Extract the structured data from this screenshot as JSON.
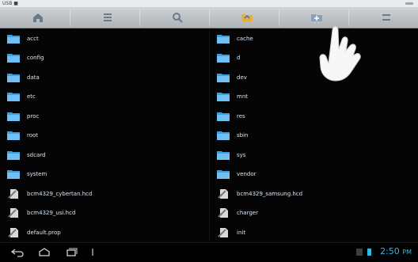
{
  "status": {
    "left_text": "USB ■"
  },
  "toolbar": {
    "buttons": [
      {
        "name": "home-icon"
      },
      {
        "name": "list-view-icon"
      },
      {
        "name": "search-icon"
      },
      {
        "name": "folder-up-icon"
      },
      {
        "name": "new-folder-icon"
      },
      {
        "name": "menu-icon"
      }
    ]
  },
  "files": {
    "left": [
      {
        "name": "acct",
        "type": "folder"
      },
      {
        "name": "config",
        "type": "folder"
      },
      {
        "name": "data",
        "type": "folder"
      },
      {
        "name": "etc",
        "type": "folder"
      },
      {
        "name": "proc",
        "type": "folder"
      },
      {
        "name": "root",
        "type": "folder"
      },
      {
        "name": "sdcard",
        "type": "folder"
      },
      {
        "name": "system",
        "type": "folder"
      },
      {
        "name": "bcm4329_cybertan.hcd",
        "type": "file"
      },
      {
        "name": "bcm4329_usi.hcd",
        "type": "file"
      },
      {
        "name": "default.prop",
        "type": "file"
      }
    ],
    "right": [
      {
        "name": "cache",
        "type": "folder"
      },
      {
        "name": "d",
        "type": "folder"
      },
      {
        "name": "dev",
        "type": "folder"
      },
      {
        "name": "mnt",
        "type": "folder"
      },
      {
        "name": "res",
        "type": "folder"
      },
      {
        "name": "sbin",
        "type": "folder"
      },
      {
        "name": "sys",
        "type": "folder"
      },
      {
        "name": "vendor",
        "type": "folder"
      },
      {
        "name": "bcm4329_samsung.hcd",
        "type": "file"
      },
      {
        "name": "charger",
        "type": "file"
      },
      {
        "name": "init",
        "type": "file"
      }
    ]
  },
  "navbar": {
    "buttons": [
      {
        "name": "back-icon"
      },
      {
        "name": "home-nav-icon"
      },
      {
        "name": "recent-apps-icon"
      }
    ],
    "clock": "2:50",
    "clock_suffix": "PM"
  },
  "colors": {
    "accent": "#33b5e5",
    "folder": "#3a9fe0",
    "text": "#d9e6f5"
  }
}
